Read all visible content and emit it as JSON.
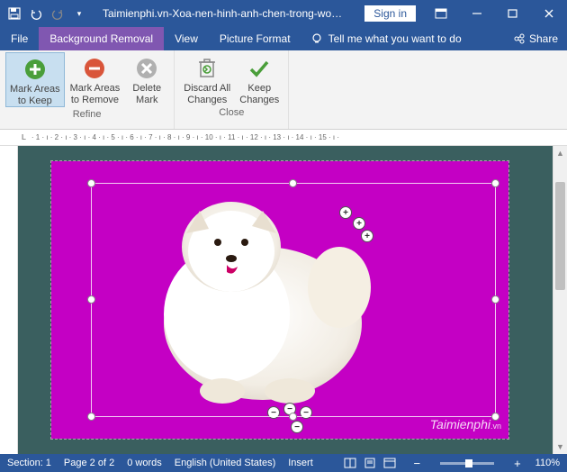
{
  "titlebar": {
    "filename": "Taimienphi.vn-Xoa-nen-hinh-anh-chen-trong-word...",
    "signin": "Sign in"
  },
  "tabs": {
    "file": "File",
    "background_removal": "Background Removal",
    "review": "View",
    "picture_format": "Picture Format",
    "tellme": "Tell me what you want to do",
    "share": "Share"
  },
  "ribbon": {
    "refine": {
      "label": "Refine",
      "mark_keep_l1": "Mark Areas",
      "mark_keep_l2": "to Keep",
      "mark_remove_l1": "Mark Areas",
      "mark_remove_l2": "to Remove",
      "delete_l1": "Delete",
      "delete_l2": "Mark"
    },
    "close": {
      "label": "Close",
      "discard_l1": "Discard All",
      "discard_l2": "Changes",
      "keep_l1": "Keep",
      "keep_l2": "Changes"
    }
  },
  "ruler": {
    "l": "L",
    "ticks": "· 1 · ı · 2 · ı · 3 · ı · 4 · ı · 5 · ı · 6 · ı · 7 · ı · 8 · ı · 9 · ı · 10 · ı · 11 · ı · 12 · ı · 13 · ı · 14 · ı · 15 · ı ·"
  },
  "canvas": {
    "watermark": "Taimienphi",
    "watermark_vn": ".vn"
  },
  "status": {
    "section": "Section: 1",
    "page": "Page 2 of 2",
    "words": "0 words",
    "lang": "English (United States)",
    "insert": "Insert",
    "zoom_minus": "−",
    "zoom_plus": "+",
    "zoom_pct": "110%"
  }
}
